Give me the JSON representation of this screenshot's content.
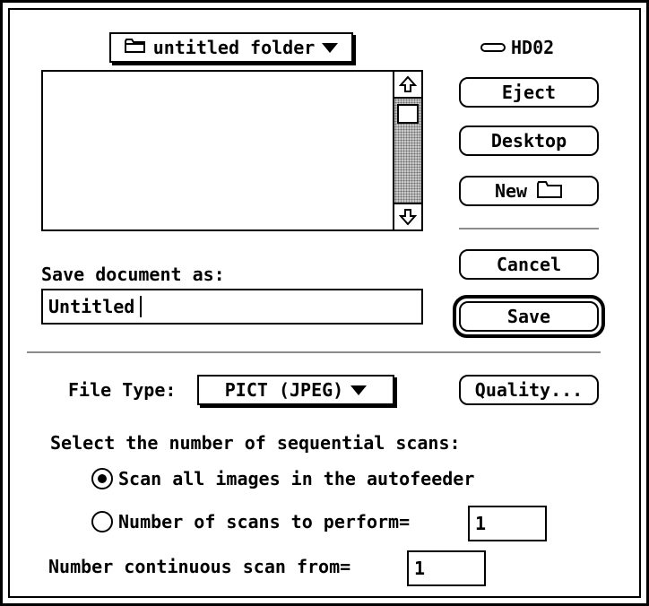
{
  "folder_popup": {
    "label": "untitled folder"
  },
  "disk": {
    "name": "HD02"
  },
  "buttons": {
    "eject": "Eject",
    "desktop": "Desktop",
    "new": "New",
    "cancel": "Cancel",
    "save": "Save",
    "quality": "Quality..."
  },
  "save_as": {
    "label": "Save document as:",
    "value": "Untitled"
  },
  "file_type": {
    "label": "File Type:",
    "selected": "PICT (JPEG)"
  },
  "scans": {
    "heading": "Select the number of sequential scans:",
    "option_all": "Scan all images in the autofeeder",
    "option_number": "Number of scans to perform=",
    "number_value": "1",
    "selected_option": "option_all"
  },
  "continuous": {
    "label": "Number continuous scan from=",
    "value": "1"
  }
}
